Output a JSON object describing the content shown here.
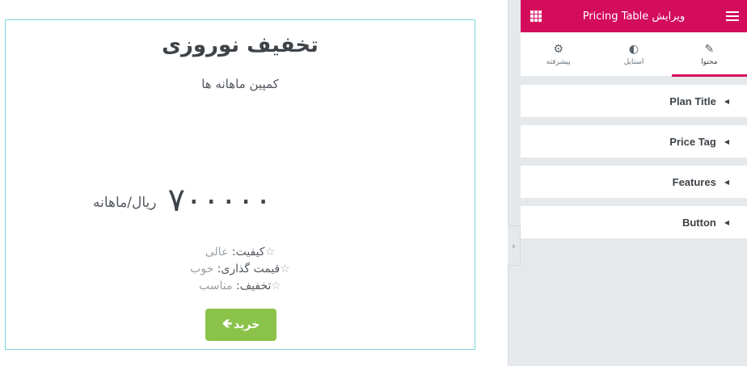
{
  "preview": {
    "title": "تخفیف نوروزی",
    "subtitle": "کمپین ماهانه ها",
    "price": {
      "amount": "۷۰۰۰۰۰",
      "currency": "ریال/ماهانه"
    },
    "features": [
      {
        "icon": "star-outline-icon",
        "label": "کیفیت:",
        "value": "عالی"
      },
      {
        "icon": "star-outline-icon",
        "label": "قیمت گذاری:",
        "value": "خوب"
      },
      {
        "icon": "star-outline-icon",
        "label": "تخفیف:",
        "value": "مناسب"
      }
    ],
    "button": {
      "label": "خرید",
      "icon": "arrow-left-icon",
      "color": "#8bc34a"
    }
  },
  "panel": {
    "header": {
      "title": "ویرایش Pricing Table",
      "color": "#d30c5c"
    },
    "tabs": [
      {
        "label": "محتوا",
        "icon": "pencil-icon",
        "active": true
      },
      {
        "label": "استایل",
        "icon": "half-circle-icon",
        "active": false
      },
      {
        "label": "پیشرفته",
        "icon": "gear-icon",
        "active": false
      }
    ],
    "sections": [
      {
        "label": "Plan Title"
      },
      {
        "label": "Price Tag"
      },
      {
        "label": "Features"
      },
      {
        "label": "Button"
      }
    ]
  }
}
